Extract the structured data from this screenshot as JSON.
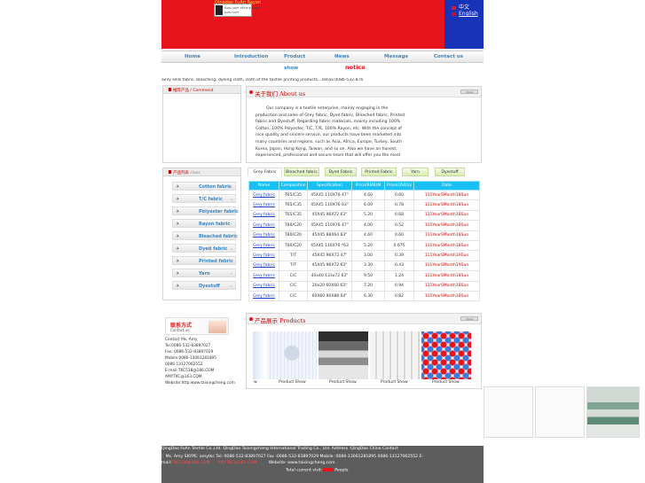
{
  "header": {
    "company_title": "Qingdao FuAn Rayon",
    "logo_text": "DAPA SOFT TEXTILE SCENE",
    "lang_cn": "中文",
    "lang_en": "English",
    "bg_color": "#e8141b",
    "lang_bg_color": "#1733b8"
  },
  "nav": {
    "items": [
      "Home",
      "Introduction",
      "Product",
      "News",
      "Message",
      "Contact us"
    ],
    "show": "show",
    "notice": "notice"
  },
  "marquee": "ainly sells fabric, bleaching, dyeing cloth, cloth of the textile printing products...TelFax:0086-532-876",
  "left": {
    "recommend_title": "推荐产品 / Commend",
    "category_title": "产品列表",
    "category_title_en": "class",
    "categories": [
      "Cotton fabric",
      "T/C fabric",
      "Polyester fabric",
      "Rayon fabric",
      "Bleached fabric",
      "Dyed fabric",
      "Printed fabric",
      "Yarn",
      "Dyestuff"
    ],
    "contact_title": "联系方式",
    "contact_title_en": "Contact us",
    "contact_lines": [
      "Contact  Ms. Amy",
      "Tel:0086-532-83897027",
      "Fax: 0086-532-83897029",
      "Mobile  0086-13061281895",
      "           0086-13127062552",
      "E-mail:TKC518@186.COM",
      "           AMYTKC@163.COM",
      "Website:http:www.taixingcheng.com"
    ]
  },
  "about": {
    "title": "关于我们",
    "title_en": "About us",
    "more": "more",
    "text": "Our company is a textile enterprise, mainly engaging in the production and sales of Grey fabric, Dyed fabric, Bleached fabric, Printed fabric and Dyestuff. Regarding fabric materials, mainly including 100% Cotton, 100% Polyester, T/C, T/R, 100% Rayon, etc. With the concept of nice quality and sincere service, our products have been marketed into many countries and regions, such as Asia, Africa, Europe, Turkey, South Korea, Japan, Hong Kong, Taiwan, and so on. Also we have an honest, experienced, professional and secure team that will offer you the most"
  },
  "tabs": [
    "Grey Fabric",
    "Bleached fabric",
    "Dyed Fabric",
    "Printed Fabric",
    "Yarn",
    "Dyestuff"
  ],
  "table": {
    "headers": [
      "Name",
      "Composition",
      "Specification",
      "Price(RMB)M",
      "Price(USD)/y",
      "Date"
    ],
    "rows": [
      [
        "Grey fabric",
        "T65/C35",
        "45X45  110X76    47\"",
        "4.60",
        "0.60",
        "111YearSMonth18Sun"
      ],
      [
        "Grey fabric",
        "T65/C35",
        "45X45  110X76    63\"",
        "6.00",
        "0.78",
        "111YearSMonth18Sun"
      ],
      [
        "Grey fabric",
        "T65/C35",
        "45X45    96X72    63\"",
        "5.20",
        "0.68",
        "111YearSMonth18Sun"
      ],
      [
        "Grey fabric",
        "T80/C20",
        "45X45  110X76    47\"",
        "4.00",
        "0.52",
        "111YearSMonth18Sun"
      ],
      [
        "Grey fabric",
        "T80/C20",
        "45X45    88X64    63\"",
        "4.60",
        "0.60",
        "111YearSMonth18Sun"
      ],
      [
        "Grey fabric",
        "T80/C20",
        "45X45  110X76   *63",
        "5.20",
        "0.675",
        "111YearSMonth18Sun"
      ],
      [
        "Grey fabric",
        "T/T",
        "45X45    96X72    47\"",
        "3.00",
        "0.39",
        "111YearSMonth19Sun"
      ],
      [
        "Grey fabric",
        "T/T",
        "45X45    96X72    63\"",
        "3.30",
        "0.43",
        "111YearSMonth19Sun"
      ],
      [
        "Grey fabric",
        "C/C",
        "40x40   133x72    63\"",
        "9.50",
        "1.24",
        "111YearSMonth18Sun"
      ],
      [
        "Grey fabric",
        "C/C",
        "20x20    60X60    63\"",
        "7.20",
        "0.94",
        "111YearSMonth18Sun"
      ],
      [
        "Grey fabric",
        "C/C",
        "60X60    90X88    64\"",
        "6.30",
        "0.82",
        "111YearSMonth18Sun"
      ]
    ]
  },
  "products": {
    "title": "产品展示",
    "title_en": "Products",
    "more": "more",
    "lead_caption": "w",
    "captions": [
      "Product Show",
      "Product Show",
      "Product Show",
      "Product Show"
    ]
  },
  "footer": {
    "line1": "QingDao FuAn Textile Co.,Ltd.        QingDao Taixingcheng International Trading Co., Ltd.        Address :QingDao China                          Contact",
    "line2": "：Ms. Amy    SKYPE: amytkc    Tel: 0086-532-83897027   Fax :0086-532-83897029    Mobile :0086-13061281895   0086-13127062552      E-",
    "line3_prefix": "mail:",
    "email1": "TKC518@186.COM",
    "email2": "AMYTKC@163.COM",
    "website": "Website: www.taixingcheng.com",
    "visit_prefix": "Total current visit:",
    "visit_count": "",
    "visit_suffix": "People"
  }
}
